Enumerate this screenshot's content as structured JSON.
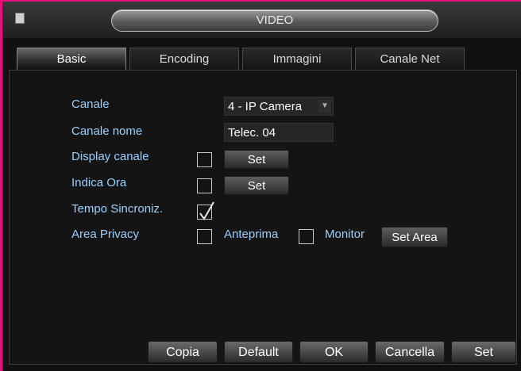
{
  "window": {
    "title": "VIDEO"
  },
  "tabs": [
    {
      "label": "Basic",
      "active": true
    },
    {
      "label": "Encoding",
      "active": false
    },
    {
      "label": "Immagini",
      "active": false
    },
    {
      "label": "Canale Net",
      "active": false
    }
  ],
  "fields": {
    "canale": {
      "label": "Canale",
      "value": "4 - IP Camera"
    },
    "canale_nome": {
      "label": "Canale nome",
      "value": "Telec. 04"
    },
    "display_canale": {
      "label": "Display canale",
      "checked": false,
      "button": "Set"
    },
    "indica_ora": {
      "label": "Indica Ora",
      "checked": false,
      "button": "Set"
    },
    "tempo_sincroniz": {
      "label": "Tempo Sincroniz.",
      "checked": true
    },
    "area_privacy": {
      "label": "Area Privacy",
      "checked": false,
      "anteprima_label": "Anteprima",
      "anteprima_checked": false,
      "monitor_label": "Monitor",
      "button": "Set Area"
    }
  },
  "footer": {
    "copia": "Copia",
    "default": "Default",
    "ok": "OK",
    "cancella": "Cancella",
    "set": "Set"
  },
  "colors": {
    "accent": "#e0147a",
    "label": "#9bd0ff"
  }
}
